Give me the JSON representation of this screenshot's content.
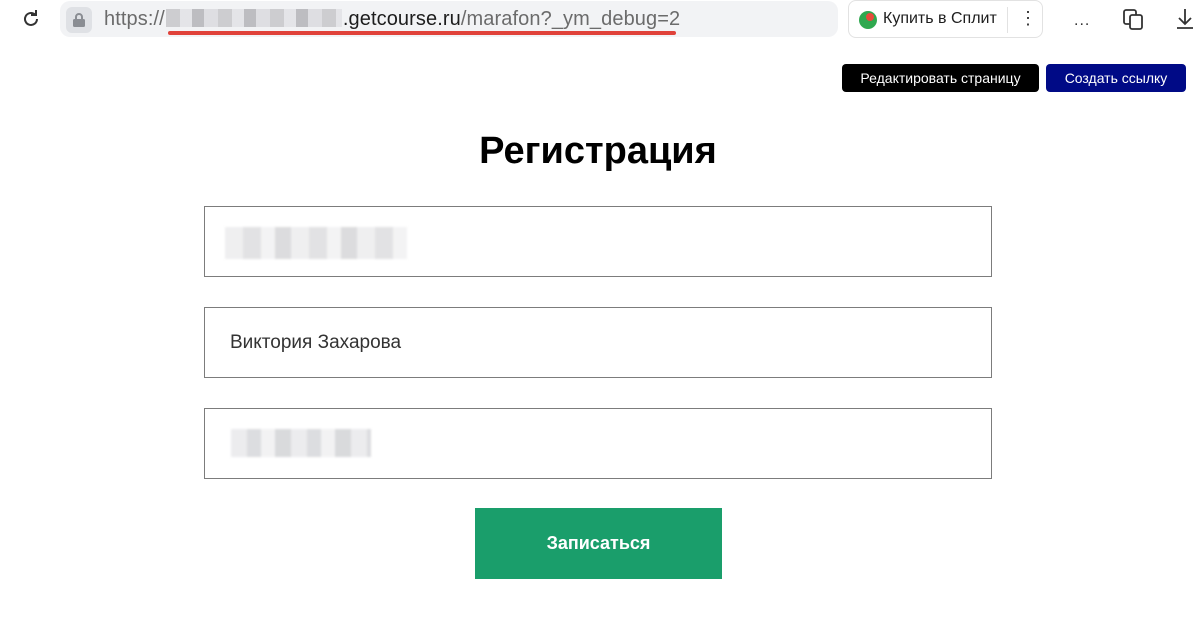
{
  "browser": {
    "url_scheme": "https://",
    "url_domain": ".getcourse.ru",
    "url_path": "/marafon?_ym_debug=2",
    "split_button_label": "Купить в Сплит",
    "more_label": "..."
  },
  "admin": {
    "edit_label": "Редактировать страницу",
    "create_link_label": "Создать ссылку"
  },
  "form": {
    "title": "Регистрация",
    "name_value": "Виктория Захарова",
    "submit_label": "Записаться"
  },
  "colors": {
    "submit": "#1a9e6b",
    "create_link": "#000a86",
    "url_underline": "#e0423a"
  }
}
